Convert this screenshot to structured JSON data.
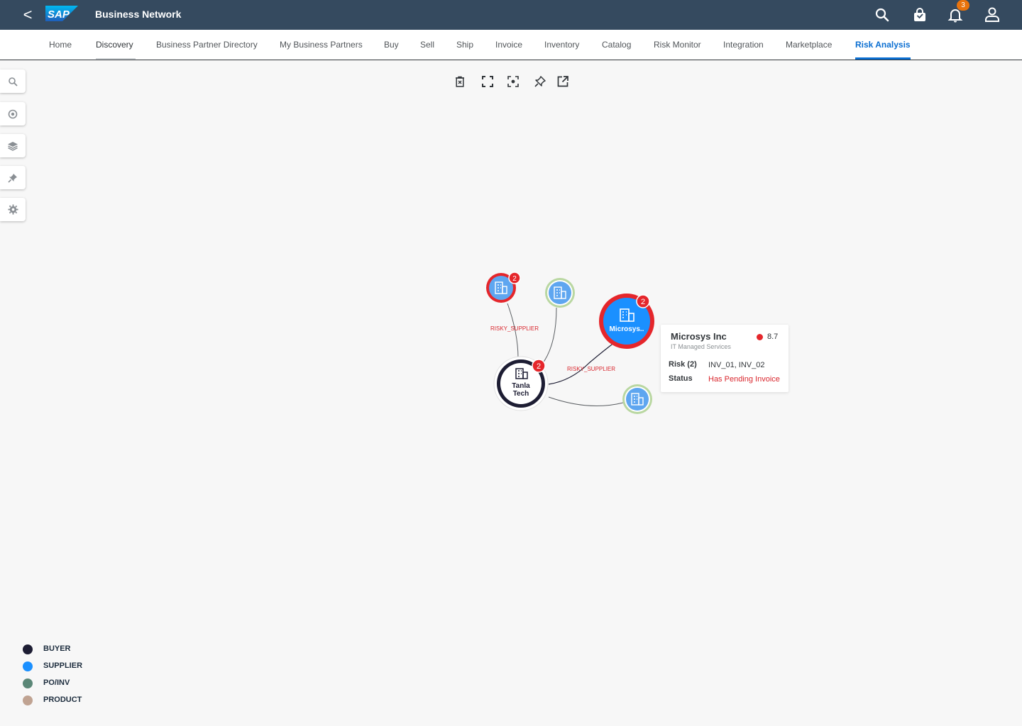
{
  "shell": {
    "back_label": "<",
    "logo_text": "SAP",
    "app_title": "Business Network",
    "notification_count": "3",
    "colors": {
      "shell_bg": "#354a5f",
      "badge": "#e9730c"
    }
  },
  "nav": {
    "items": [
      {
        "label": "Home"
      },
      {
        "label": "Discovery"
      },
      {
        "label": "Business Partner Directory"
      },
      {
        "label": "My Business Partners"
      },
      {
        "label": "Buy"
      },
      {
        "label": "Sell"
      },
      {
        "label": "Ship"
      },
      {
        "label": "Invoice"
      },
      {
        "label": "Inventory"
      },
      {
        "label": "Catalog"
      },
      {
        "label": "Risk Monitor"
      },
      {
        "label": "Integration"
      },
      {
        "label": "Marketplace"
      },
      {
        "label": "Risk Analysis"
      }
    ],
    "active": "Risk Analysis",
    "accent": "#0a6ed1"
  },
  "side_tools": [
    "search-icon",
    "eye-icon",
    "layers-icon",
    "pin-icon",
    "gear-icon"
  ],
  "graph_tools": [
    "delete-icon",
    "fullscreen-icon",
    "focus-icon",
    "pin-icon",
    "open-external-icon"
  ],
  "graph": {
    "edge_labels": [
      "RISKY_SUPPLIER",
      "RISKY_SUPPLIER"
    ],
    "nodes": {
      "center": {
        "label_line1": "Tanla",
        "label_line2": "Tech",
        "badge": "2"
      },
      "top_left": {
        "badge": "2"
      },
      "selected": {
        "label": "Microsys..",
        "badge": "2"
      }
    },
    "colors": {
      "supplier": "#1b90ff",
      "risk": "#e5262b",
      "ok_ring": "#b9d7a1",
      "buyer": "#1d1d33",
      "edge_label": "#d9272e"
    }
  },
  "tooltip": {
    "title": "Microsys Inc",
    "subtitle": "IT Managed Services",
    "score": "8.7",
    "risk_label": "Risk (2)",
    "risk_value": "INV_01, INV_02",
    "status_label": "Status",
    "status_value": "Has Pending Invoice"
  },
  "legend": [
    {
      "label": "BUYER",
      "color": "#1d1d33"
    },
    {
      "label": "SUPPLIER",
      "color": "#1b90ff"
    },
    {
      "label": "PO/INV",
      "color": "#5b8777"
    },
    {
      "label": "PRODUCT",
      "color": "#c0a392"
    }
  ]
}
